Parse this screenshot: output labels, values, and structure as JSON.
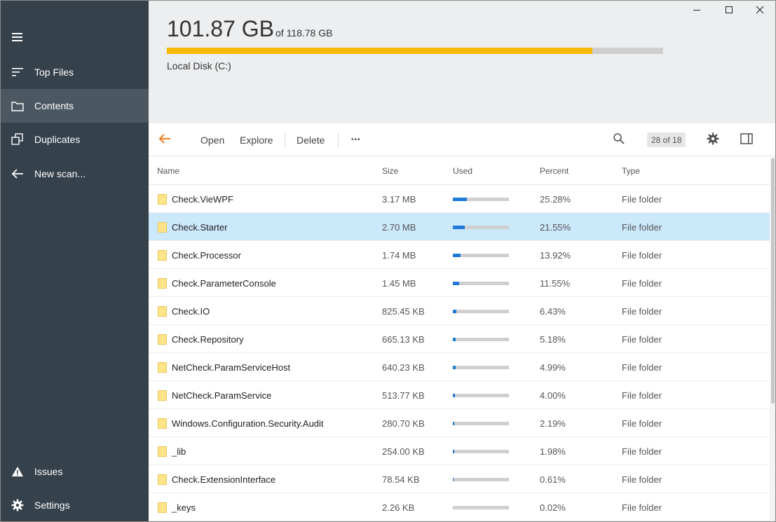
{
  "sidebar": {
    "items": [
      {
        "label": "Top Files",
        "icon": "list-icon"
      },
      {
        "label": "Contents",
        "icon": "folder-icon"
      },
      {
        "label": "Duplicates",
        "icon": "duplicates-icon"
      },
      {
        "label": "New scan...",
        "icon": "arrow-left-icon"
      },
      {
        "label": "Issues",
        "icon": "warning-icon"
      },
      {
        "label": "Settings",
        "icon": "gear-icon"
      }
    ],
    "active": "Contents"
  },
  "header": {
    "used": "101.87 GB",
    "of_total": "of 118.78 GB",
    "disk_name": "Local Disk (C:)",
    "usage_fraction": 0.8576,
    "bar_color": "#f6b800"
  },
  "toolbar": {
    "open_label": "Open",
    "explore_label": "Explore",
    "delete_label": "Delete",
    "more_label": "•••",
    "counter": "28 of 18"
  },
  "table": {
    "columns": [
      "Name",
      "Size",
      "Used",
      "Percent",
      "Type"
    ],
    "rows": [
      {
        "name": "Check.VieWPF",
        "size": "3.17 MB",
        "used": 0.2528,
        "percent": "25.28%",
        "type": "File folder"
      },
      {
        "name": "Check.Starter",
        "size": "2.70 MB",
        "used": 0.2155,
        "percent": "21.55%",
        "type": "File folder",
        "selected": true
      },
      {
        "name": "Check.Processor",
        "size": "1.74 MB",
        "used": 0.1392,
        "percent": "13.92%",
        "type": "File folder"
      },
      {
        "name": "Check.ParameterConsole",
        "size": "1.45 MB",
        "used": 0.1155,
        "percent": "11.55%",
        "type": "File folder"
      },
      {
        "name": "Check.IO",
        "size": "825.45 KB",
        "used": 0.0643,
        "percent": "6.43%",
        "type": "File folder"
      },
      {
        "name": "Check.Repository",
        "size": "665.13 KB",
        "used": 0.0518,
        "percent": "5.18%",
        "type": "File folder"
      },
      {
        "name": "NetCheck.ParamServiceHost",
        "size": "640.23 KB",
        "used": 0.0499,
        "percent": "4.99%",
        "type": "File folder"
      },
      {
        "name": "NetCheck.ParamService",
        "size": "513.77 KB",
        "used": 0.04,
        "percent": "4.00%",
        "type": "File folder"
      },
      {
        "name": "Windows.Configuration.Security.Audit",
        "size": "280.70 KB",
        "used": 0.0219,
        "percent": "2.19%",
        "type": "File folder"
      },
      {
        "name": "_lib",
        "size": "254.00 KB",
        "used": 0.0198,
        "percent": "1.98%",
        "type": "File folder"
      },
      {
        "name": "Check.ExtensionInterface",
        "size": "78.54 KB",
        "used": 0.0061,
        "percent": "0.61%",
        "type": "File folder"
      },
      {
        "name": "_keys",
        "size": "2.26 KB",
        "used": 0.0002,
        "percent": "0.02%",
        "type": "File folder"
      }
    ]
  },
  "colors": {
    "sidebar_bg": "#35414b",
    "sidebar_active": "#4c5861",
    "accent_orange": "#f07d1e",
    "used_bar": "#1d7ad6",
    "selected_row": "#cce8fb"
  }
}
